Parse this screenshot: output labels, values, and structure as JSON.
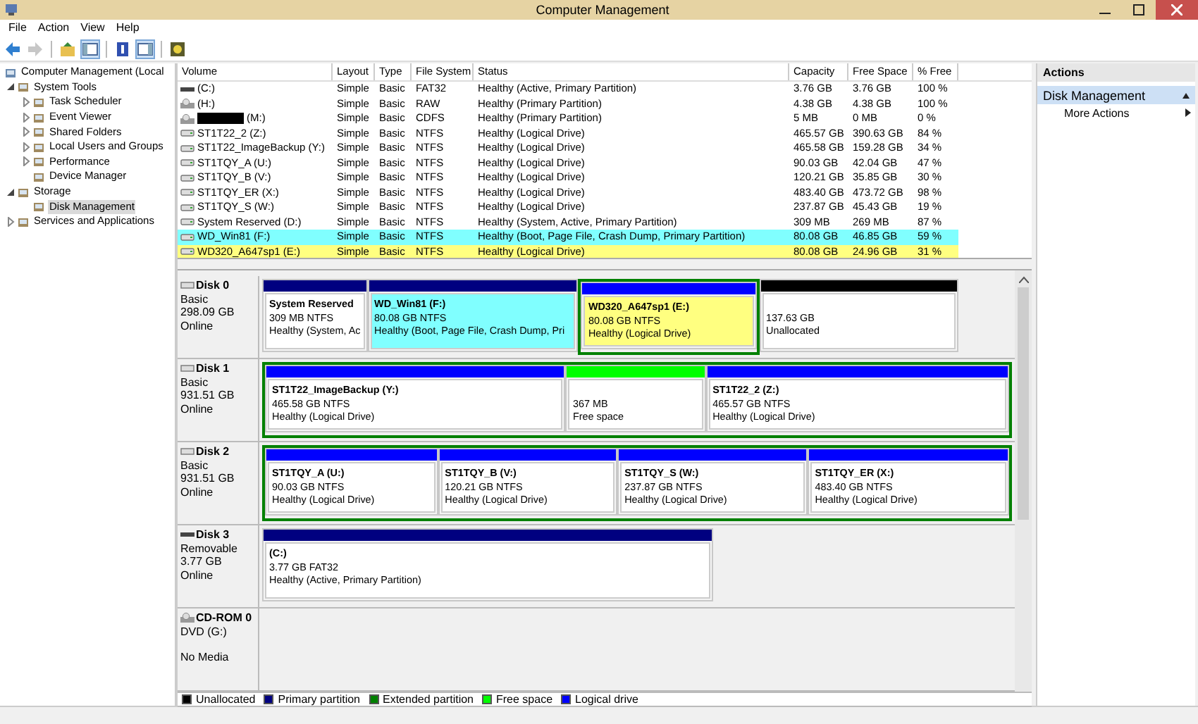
{
  "window": {
    "title": "Computer Management"
  },
  "menu": [
    "File",
    "Action",
    "View",
    "Help"
  ],
  "toolbar": [
    {
      "pressed": false,
      "disabled": false
    },
    {
      "pressed": false,
      "disabled": true
    },
    {
      "pressed": false,
      "disabled": false
    },
    {
      "pressed": true,
      "disabled": false
    },
    {
      "pressed": false,
      "disabled": false
    },
    {
      "pressed": true,
      "disabled": false
    },
    {
      "pressed": false,
      "disabled": false
    }
  ],
  "tree": [
    {
      "label": "Computer Management (Local",
      "selected": false,
      "children": [
        {
          "label": "System Tools",
          "expanded": true,
          "selected": false,
          "children": [
            {
              "label": "Task Scheduler",
              "expanded": false,
              "selected": false
            },
            {
              "label": "Event Viewer",
              "expanded": false,
              "selected": false
            },
            {
              "label": "Shared Folders",
              "expanded": false,
              "selected": false
            },
            {
              "label": "Local Users and Groups",
              "expanded": false,
              "selected": false
            },
            {
              "label": "Performance",
              "expanded": false,
              "selected": false
            },
            {
              "label": "Device Manager",
              "selected": false
            }
          ]
        },
        {
          "label": "Storage",
          "expanded": true,
          "selected": false,
          "children": [
            {
              "label": "Disk Management",
              "selected": true
            }
          ]
        },
        {
          "label": "Services and Applications",
          "expanded": false,
          "selected": false
        }
      ]
    }
  ],
  "volumes": {
    "columns": [
      "Volume",
      "Layout",
      "Type",
      "File System",
      "Status",
      "Capacity",
      "Free Space",
      "% Free"
    ],
    "rows": [
      {
        "kind": "removable",
        "cells": [
          "(C:)",
          "Simple",
          "Basic",
          "FAT32",
          "Healthy (Active, Primary Partition)",
          "3.76 GB",
          "3.76 GB",
          "100 %"
        ]
      },
      {
        "kind": "optical",
        "cells": [
          "(H:)",
          "Simple",
          "Basic",
          "RAW",
          "Healthy (Primary Partition)",
          "4.38 GB",
          "4.38 GB",
          "100 %"
        ]
      },
      {
        "kind": "optical",
        "redacted": true,
        "cells": [
          "(M:)",
          "Simple",
          "Basic",
          "CDFS",
          "Healthy (Primary Partition)",
          "5 MB",
          "0 MB",
          "0 %"
        ]
      },
      {
        "kind": "hdd",
        "cells": [
          "ST1T22_2 (Z:)",
          "Simple",
          "Basic",
          "NTFS",
          "Healthy (Logical Drive)",
          "465.57 GB",
          "390.63 GB",
          "84 %"
        ]
      },
      {
        "kind": "hdd",
        "cells": [
          "ST1T22_ImageBackup (Y:)",
          "Simple",
          "Basic",
          "NTFS",
          "Healthy (Logical Drive)",
          "465.58 GB",
          "159.28 GB",
          "34 %"
        ]
      },
      {
        "kind": "hdd",
        "cells": [
          "ST1TQY_A (U:)",
          "Simple",
          "Basic",
          "NTFS",
          "Healthy (Logical Drive)",
          "90.03 GB",
          "42.04 GB",
          "47 %"
        ]
      },
      {
        "kind": "hdd",
        "cells": [
          "ST1TQY_B (V:)",
          "Simple",
          "Basic",
          "NTFS",
          "Healthy (Logical Drive)",
          "120.21 GB",
          "35.85 GB",
          "30 %"
        ]
      },
      {
        "kind": "hdd",
        "cells": [
          "ST1TQY_ER (X:)",
          "Simple",
          "Basic",
          "NTFS",
          "Healthy (Logical Drive)",
          "483.40 GB",
          "473.72 GB",
          "98 %"
        ]
      },
      {
        "kind": "hdd",
        "cells": [
          "ST1TQY_S (W:)",
          "Simple",
          "Basic",
          "NTFS",
          "Healthy (Logical Drive)",
          "237.87 GB",
          "45.43 GB",
          "19 %"
        ]
      },
      {
        "kind": "hdd",
        "cells": [
          "System Reserved (D:)",
          "Simple",
          "Basic",
          "NTFS",
          "Healthy (System, Active, Primary Partition)",
          "309 MB",
          "269 MB",
          "87 %"
        ]
      },
      {
        "kind": "hdd",
        "color": "#80ffff",
        "cells": [
          "WD_Win81 (F:)",
          "Simple",
          "Basic",
          "NTFS",
          "Healthy (Boot, Page File, Crash Dump, Primary Partition)",
          "80.08 GB",
          "46.85 GB",
          "59 %"
        ]
      },
      {
        "kind": "hdd",
        "color": "#ffff80",
        "cells": [
          "WD320_A647sp1 (E:)",
          "Simple",
          "Basic",
          "NTFS",
          "Healthy (Logical Drive)",
          "80.08 GB",
          "24.96 GB",
          "31 %"
        ]
      }
    ]
  },
  "disks": [
    {
      "kind": "disk",
      "name": "Disk 0",
      "lines": [
        "Basic",
        "298.09 GB",
        "Online"
      ],
      "partitions": [
        {
          "kind": "primary",
          "name": "System Reserved",
          "size": "309 MB NTFS",
          "status": "Healthy (System, Ac"
        },
        {
          "kind": "primary",
          "color": "#80ffff",
          "name": "WD_Win81  (F:)",
          "size": "80.08 GB NTFS",
          "status": "Healthy (Boot, Page File, Crash Dump, Pri"
        },
        {
          "kind": "extended",
          "children": [
            {
              "kind": "logical",
              "color": "#ffff80",
              "name": "WD320_A647sp1  (E:)",
              "size": "80.08 GB NTFS",
              "status": "Healthy (Logical Drive)"
            }
          ]
        },
        {
          "kind": "unallocated",
          "size": "137.63 GB",
          "status": "Unallocated"
        }
      ]
    },
    {
      "kind": "disk",
      "name": "Disk 1",
      "lines": [
        "Basic",
        "931.51 GB",
        "Online"
      ],
      "partitions": [
        {
          "kind": "extended",
          "children": [
            {
              "kind": "logical",
              "name": "ST1T22_ImageBackup  (Y:)",
              "size": "465.58 GB NTFS",
              "status": "Healthy (Logical Drive)"
            },
            {
              "kind": "free",
              "size": "367 MB",
              "status": "Free space"
            },
            {
              "kind": "logical",
              "name": "ST1T22_2  (Z:)",
              "size": "465.57 GB NTFS",
              "status": "Healthy (Logical Drive)"
            }
          ]
        }
      ]
    },
    {
      "kind": "disk",
      "name": "Disk 2",
      "lines": [
        "Basic",
        "931.51 GB",
        "Online"
      ],
      "partitions": [
        {
          "kind": "extended",
          "children": [
            {
              "kind": "logical",
              "name": "ST1TQY_A  (U:)",
              "size": "90.03 GB NTFS",
              "status": "Healthy (Logical Drive)"
            },
            {
              "kind": "logical",
              "name": "ST1TQY_B  (V:)",
              "size": "120.21 GB NTFS",
              "status": "Healthy (Logical Drive)"
            },
            {
              "kind": "logical",
              "name": "ST1TQY_S  (W:)",
              "size": "237.87 GB NTFS",
              "status": "Healthy (Logical Drive)"
            },
            {
              "kind": "logical",
              "name": "ST1TQY_ER  (X:)",
              "size": "483.40 GB NTFS",
              "status": "Healthy (Logical Drive)"
            }
          ]
        }
      ]
    },
    {
      "kind": "removable",
      "name": "Disk 3",
      "lines": [
        "Removable",
        "3.77 GB",
        "Online"
      ],
      "partitions": [
        {
          "kind": "primary",
          "name": "(C:)",
          "size": "3.77 GB FAT32",
          "status": "Healthy (Active, Primary Partition)"
        }
      ]
    },
    {
      "kind": "cdrom",
      "name": "CD-ROM 0",
      "lines": [
        "DVD (G:)",
        "No Media"
      ]
    }
  ],
  "legend": [
    {
      "label": "Unallocated",
      "color": "#000000"
    },
    {
      "label": "Primary partition",
      "color": "#000080"
    },
    {
      "label": "Extended partition",
      "color": "#008000"
    },
    {
      "label": "Free space",
      "color": "#00ff00"
    },
    {
      "label": "Logical drive",
      "color": "#0000ff"
    }
  ],
  "actions": {
    "title": "Actions",
    "section": "Disk Management",
    "items": [
      "More Actions"
    ]
  }
}
